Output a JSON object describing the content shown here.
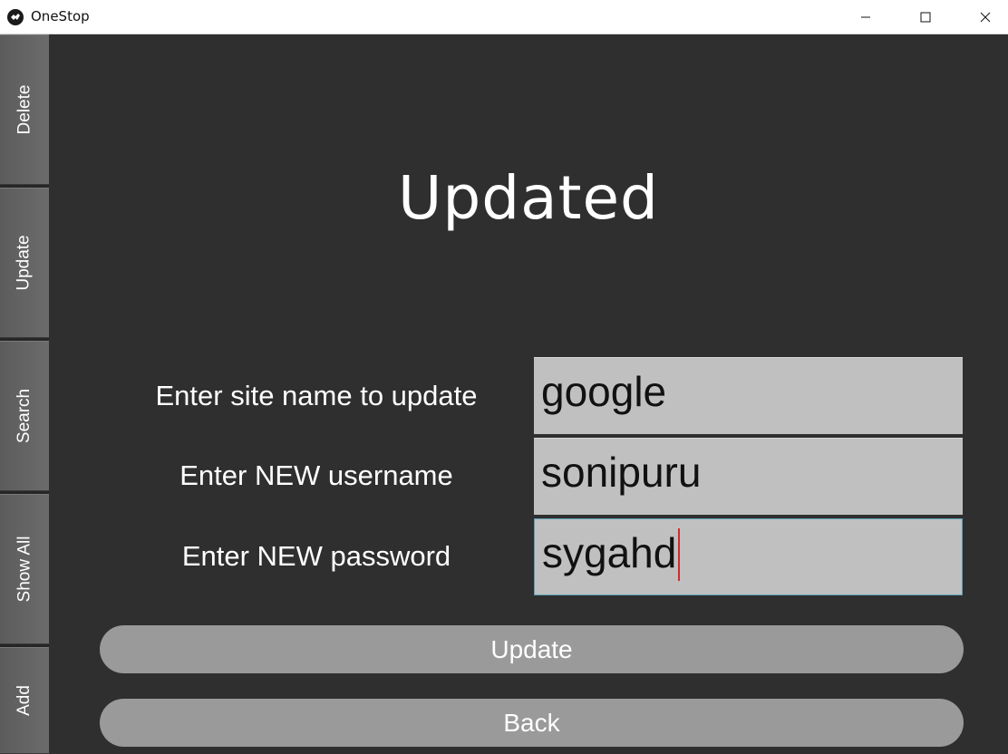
{
  "window": {
    "title": "OneStop",
    "icon": "app-logo-icon",
    "controls": [
      "minimize-icon",
      "maximize-icon",
      "close-icon"
    ]
  },
  "sidebar": {
    "tabs": [
      {
        "label": "Delete"
      },
      {
        "label": "Update"
      },
      {
        "label": "Search"
      },
      {
        "label": "Show All"
      },
      {
        "label": "Add"
      }
    ]
  },
  "main": {
    "heading": "Updated",
    "fields": [
      {
        "label": "Enter site name to update",
        "value": "google"
      },
      {
        "label": "Enter NEW username",
        "value": "sonipuru"
      },
      {
        "label": "Enter NEW password",
        "value": "sygahd"
      }
    ],
    "buttons": {
      "update": "Update",
      "back": "Back"
    }
  },
  "colors": {
    "background": "#2f2f2f",
    "tab": "#666666",
    "field": "#c0c0c0",
    "button": "#9a9a9a",
    "caret": "#d22a2a",
    "focus_border": "#5aa0b8"
  }
}
